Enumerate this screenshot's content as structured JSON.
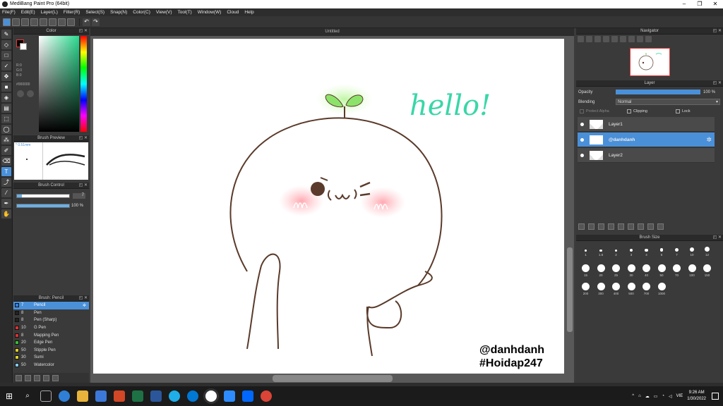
{
  "window": {
    "title": "MediBang Paint Pro (64bit)",
    "controls": [
      "–",
      "❐",
      "✕"
    ]
  },
  "menu": [
    "File(F)",
    "Edit(E)",
    "Layer(L)",
    "Filter(R)",
    "Select(S)",
    "Snap(N)",
    "Color(C)",
    "View(V)",
    "Tool(T)",
    "Window(W)",
    "Cloud",
    "Help"
  ],
  "color_panel": {
    "title": "Color",
    "r": "R:0",
    "g": "G:0",
    "b": "B:0",
    "hex": "#000000",
    "fg": "#000000",
    "bg": "#ffffff"
  },
  "brush_preview": {
    "title": "Brush Preview",
    "size": "* 0.51mm"
  },
  "brush_control": {
    "title": "Brush Control",
    "size_value": "7",
    "opacity_value": "100 %",
    "opacity": 1.0,
    "size_fraction": 0.1
  },
  "brush_list": {
    "title": "Brush: Pencil",
    "items": [
      {
        "size": "7",
        "name": "Pencil",
        "color": "#3a7bd5",
        "selected": true
      },
      {
        "size": "8",
        "name": "Pen",
        "color": "#222222"
      },
      {
        "size": "8",
        "name": "Pen (Sharp)",
        "color": "#222222"
      },
      {
        "size": "10",
        "name": "G Pen",
        "color": "#e03030"
      },
      {
        "size": "8",
        "name": "Mapping Pen",
        "color": "#e03030"
      },
      {
        "size": "20",
        "name": "Edge Pen",
        "color": "#30c030"
      },
      {
        "size": "50",
        "name": "Stipple Pen",
        "color": "#e0d020"
      },
      {
        "size": "30",
        "name": "Sumi",
        "color": "#e0d020"
      },
      {
        "size": "50",
        "name": "Watercolor",
        "color": "#7ec8f0"
      }
    ]
  },
  "canvas": {
    "tab_title": "Untitled",
    "hello_text": "hello!",
    "credit_line1": "@danhdanh",
    "credit_line2": "#Hoidap247"
  },
  "navigator": {
    "title": "Navigator"
  },
  "layer_panel": {
    "title": "Layer",
    "opacity_label": "Opacity",
    "opacity_value": "100 %",
    "opacity": 1.0,
    "blending_label": "Blending",
    "blending_value": "Normal",
    "protect_alpha": "Protect Alpha",
    "clipping": "Clipping",
    "lock": "Lock",
    "layers": [
      {
        "name": "Layer1",
        "selected": false
      },
      {
        "name": "@danhdanh",
        "selected": true
      },
      {
        "name": "Layer2",
        "selected": false
      }
    ]
  },
  "brush_size": {
    "title": "Brush Size",
    "sizes": [
      "1",
      "1.5",
      "2",
      "3",
      "4",
      "5",
      "7",
      "10",
      "12",
      "15",
      "20",
      "25",
      "30",
      "40",
      "50",
      "70",
      "100",
      "150",
      "200",
      "300",
      "400",
      "500",
      "700",
      "1000"
    ]
  },
  "taskbar": {
    "time": "9:26 AM",
    "date": "1/30/2022",
    "lang": "VIE"
  }
}
